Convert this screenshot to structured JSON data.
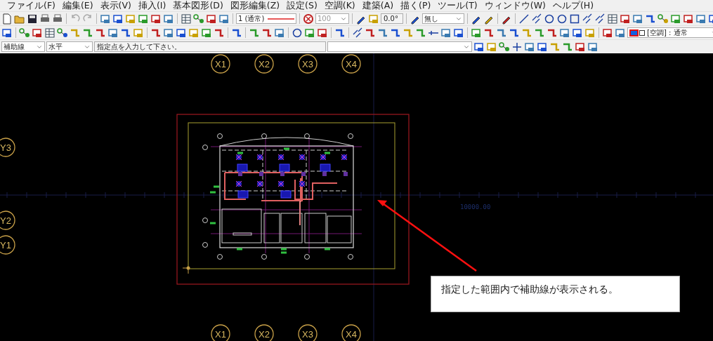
{
  "menu": [
    "ファイル(F)",
    "編集(E)",
    "表示(V)",
    "挿入(I)",
    "基本図形(D)",
    "図形編集(Z)",
    "設定(S)",
    "空調(K)",
    "建築(A)",
    "描く(P)",
    "ツール(T)",
    "ウィンドウ(W)",
    "ヘルプ(H)"
  ],
  "toolbar": {
    "line_style": "1 (通常)",
    "scale": {
      "value": "100",
      "disabled": true
    },
    "angle": "0.0°",
    "fill": "無し",
    "layer": "[空調] : 通常"
  },
  "option_bar": {
    "line_kind": "補助線",
    "direction": "水平",
    "prompt": "指定点を入力して下さい。"
  },
  "canvas": {
    "grid_x_top": [
      "X1",
      "X2",
      "X3",
      "X4"
    ],
    "grid_x_bottom": [
      "X1",
      "X2",
      "X3",
      "X4"
    ],
    "grid_y": [
      "Y3",
      "Y2",
      "Y1"
    ],
    "dimension": "10000.00",
    "callout": "指定した範囲内で補助線が表示される。"
  }
}
